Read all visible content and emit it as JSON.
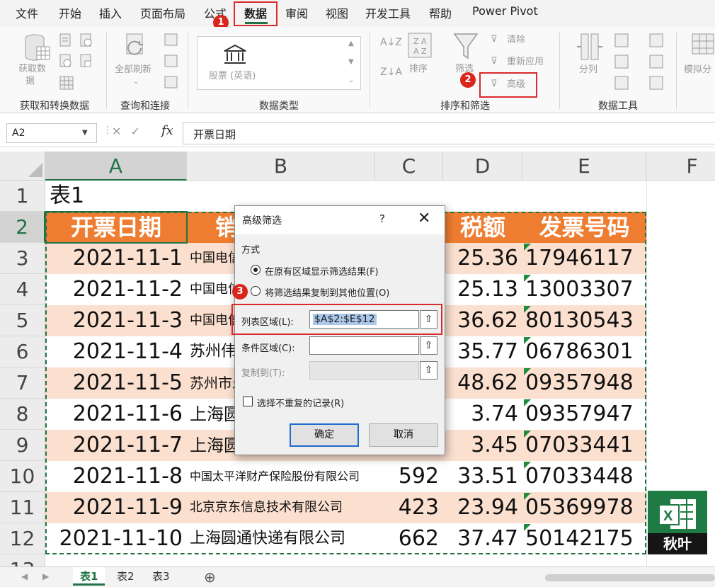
{
  "menu": {
    "tabs": [
      "文件",
      "开始",
      "插入",
      "页面布局",
      "公式",
      "数据",
      "审阅",
      "视图",
      "开发工具",
      "帮助",
      "Power Pivot"
    ],
    "active_tab": "数据"
  },
  "annotations": {
    "step1": "1",
    "step2": "2",
    "step3": "3",
    "accent": "#d92b2b"
  },
  "ribbon": {
    "get_data": {
      "label_line1": "获取数",
      "label_line2": "据",
      "group": "获取和转换数据"
    },
    "refresh": {
      "label": "全部刷新",
      "group": "查询和连接"
    },
    "data_type": {
      "label": "股票 (英语)",
      "group": "数据类型"
    },
    "sort": {
      "label": "排序",
      "group": "排序和筛选"
    },
    "filter": {
      "label": "筛选",
      "clear": "清除",
      "reapply": "重新应用",
      "advanced": "高级"
    },
    "tools": {
      "split": "分列",
      "group": "数据工具"
    },
    "whatif": {
      "label": "模拟分"
    }
  },
  "formula_bar": {
    "name_box": "A2",
    "fx": "fx",
    "value": "开票日期"
  },
  "columns": [
    "A",
    "B",
    "C",
    "D",
    "E",
    "F"
  ],
  "rows": [
    "1",
    "2",
    "3",
    "4",
    "5",
    "6",
    "7",
    "8",
    "9",
    "10",
    "11",
    "12",
    "13"
  ],
  "sheet": {
    "title": "表1",
    "headers": [
      "开票日期",
      "销",
      "税额",
      "发票号码"
    ],
    "data": [
      {
        "date": "2021-11-1",
        "company": "中国电信",
        "amount": "",
        "tax": "25.36",
        "invoice": "17946117"
      },
      {
        "date": "2021-11-2",
        "company": "中国电信",
        "amount": "",
        "tax": "25.13",
        "invoice": "13003307"
      },
      {
        "date": "2021-11-3",
        "company": "中国电信",
        "amount": "",
        "tax": "36.62",
        "invoice": "80130543"
      },
      {
        "date": "2021-11-4",
        "company": "苏州伟",
        "amount": "",
        "tax": "35.77",
        "invoice": "06786301"
      },
      {
        "date": "2021-11-5",
        "company": "苏州市乐",
        "amount": "",
        "tax": "48.62",
        "invoice": "09357948"
      },
      {
        "date": "2021-11-6",
        "company": "上海圆",
        "amount": "",
        "tax": "3.74",
        "invoice": "09357947"
      },
      {
        "date": "2021-11-7",
        "company": "上海圆",
        "amount": "",
        "tax": "3.45",
        "invoice": "07033441"
      },
      {
        "date": "2021-11-8",
        "company": "中国太平洋财产保险股份有限公司",
        "amount": "592",
        "tax": "33.51",
        "invoice": "07033448"
      },
      {
        "date": "2021-11-9",
        "company": "北京京东信息技术有限公司",
        "amount": "423",
        "tax": "23.94",
        "invoice": "05369978"
      },
      {
        "date": "2021-11-10",
        "company": "上海圆通快递有限公司",
        "amount": "662",
        "tax": "37.47",
        "invoice": "50142175"
      }
    ]
  },
  "dialog": {
    "title": "高级筛选",
    "help": "?",
    "close": "✕",
    "method_label": "方式",
    "option_inplace": "在原有区域显示筛选结果(F)",
    "option_copy": "将筛选结果复制到其他位置(O)",
    "list_range_label": "列表区域(L):",
    "list_range_value": "$A$2:$E$12",
    "criteria_label": "条件区域(C):",
    "criteria_value": "",
    "copy_to_label": "复制到(T):",
    "copy_to_value": "",
    "unique_label": "选择不重复的记录(R)",
    "ok": "确定",
    "cancel": "取消"
  },
  "sheet_tabs": {
    "tabs": [
      "表1",
      "表2",
      "表3"
    ],
    "active": "表1",
    "add": "⊕"
  },
  "logo": {
    "text": "秋叶"
  }
}
